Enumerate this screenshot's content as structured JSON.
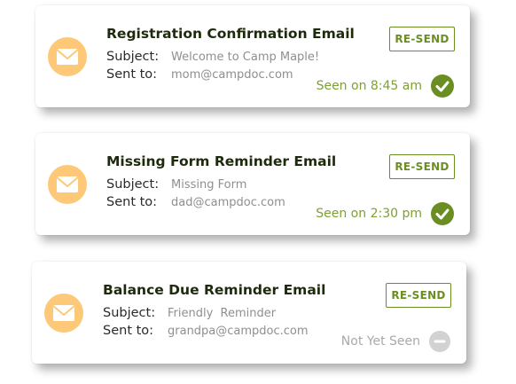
{
  "colors": {
    "accent_green": "#6b8e23",
    "seen_text": "#7da032",
    "mail_circle": "#fdc978",
    "title_text": "#1e2a0c",
    "muted_gray": "#a9a9a9"
  },
  "labels": {
    "subject": "Subject:",
    "sent_to": "Sent to:"
  },
  "emails": [
    {
      "title": "Registration Confirmation Email",
      "subject": "Welcome to Camp Maple!",
      "sent_to": "mom@campdoc.com",
      "resend_label": "RE-SEND",
      "status": "Seen on 8:45 am",
      "status_icon": "check-circle-icon"
    },
    {
      "title": "Missing Form Reminder Email",
      "subject": "Missing Form",
      "sent_to": "dad@campdoc.com",
      "resend_label": "RE-SEND",
      "status": "Seen on 2:30 pm",
      "status_icon": "check-circle-icon"
    },
    {
      "title": "Balance Due Reminder Email",
      "subject": "Friendly  Reminder",
      "sent_to": "grandpa@campdoc.com",
      "resend_label": "RE-SEND",
      "status": "Not Yet Seen",
      "status_icon": "minus-circle-icon"
    }
  ]
}
